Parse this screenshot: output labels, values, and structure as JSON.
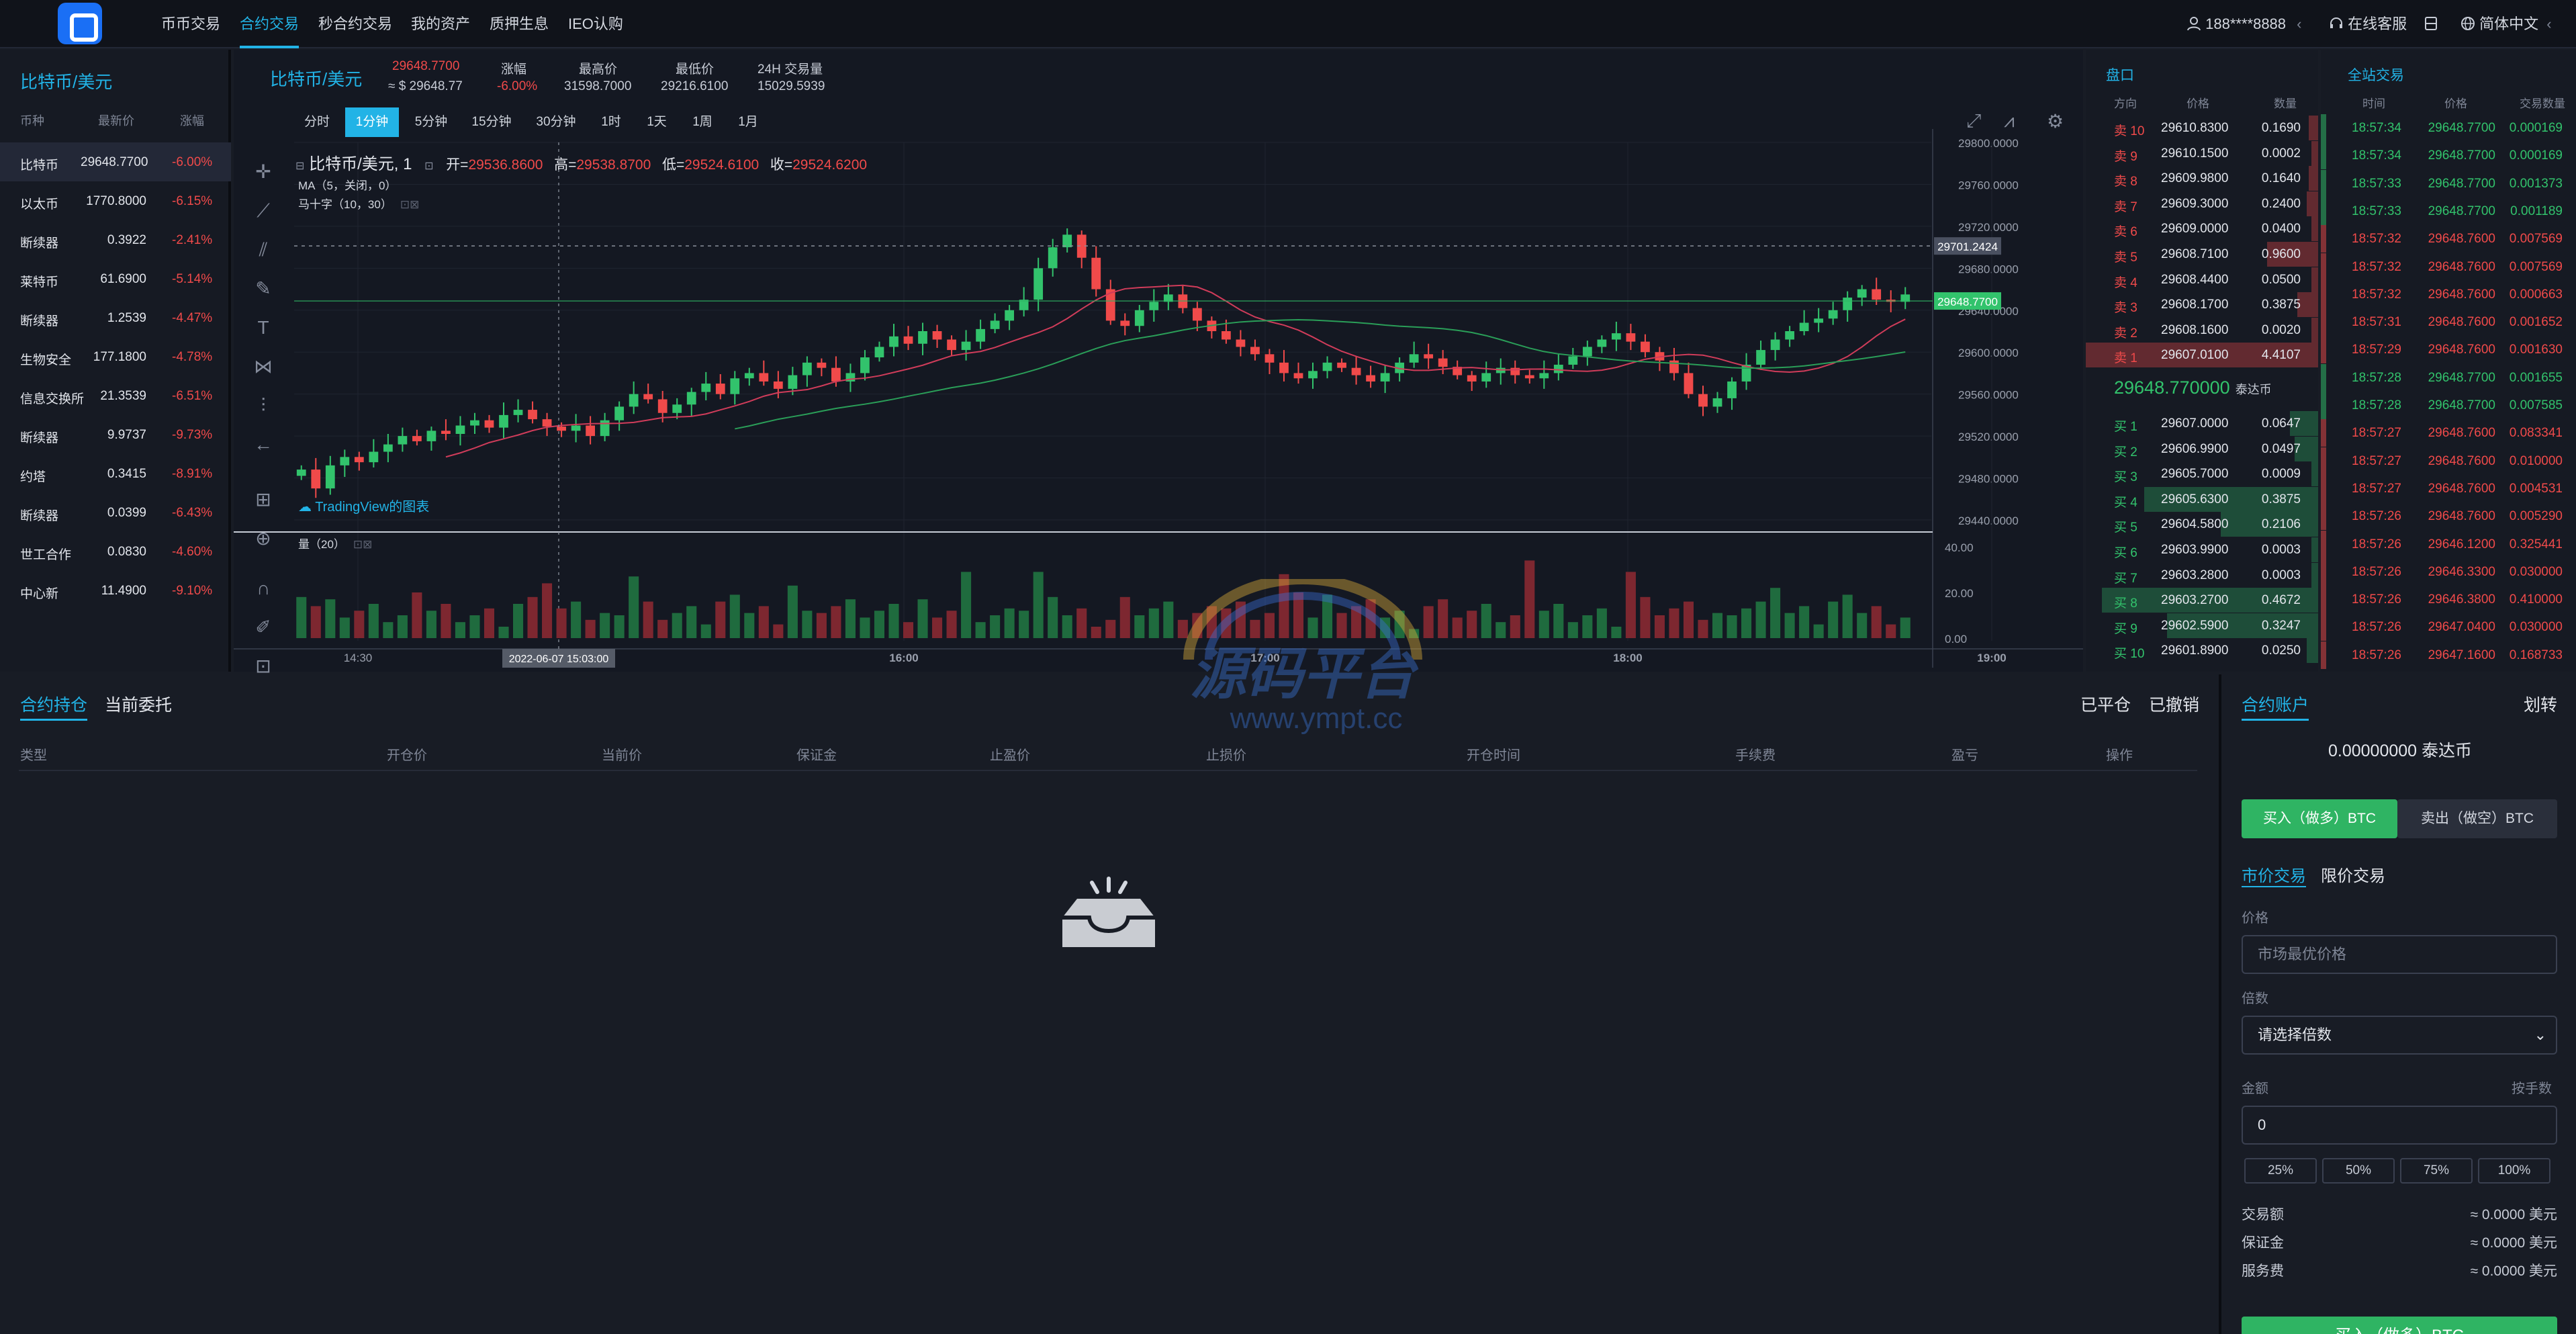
{
  "nav": {
    "items": [
      "币币交易",
      "合约交易",
      "秒合约交易",
      "我的资产",
      "质押生息",
      "IEO认购"
    ],
    "active": "合约交易",
    "user": "188****8888",
    "user_arrow": "‹",
    "service": "在线客服",
    "language": "简体中文",
    "lang_arrow": "‹"
  },
  "left_panel": {
    "title": "比特币/美元",
    "headers": [
      "币种",
      "最新价",
      "涨幅"
    ],
    "coins": [
      {
        "name": "比特币",
        "price": "29648.7700",
        "change": "-6.00%"
      },
      {
        "name": "以太币",
        "price": "1770.8000",
        "change": "-6.15%"
      },
      {
        "name": "断续器",
        "price": "0.3922",
        "change": "-2.41%"
      },
      {
        "name": "莱特币",
        "price": "61.6900",
        "change": "-5.14%"
      },
      {
        "name": "断续器",
        "price": "1.2539",
        "change": "-4.47%"
      },
      {
        "name": "生物安全",
        "price": "177.1800",
        "change": "-4.78%"
      },
      {
        "name": "信息交换所",
        "price": "21.3539",
        "change": "-6.51%"
      },
      {
        "name": "断续器",
        "price": "9.9737",
        "change": "-9.73%"
      },
      {
        "name": "约塔",
        "price": "0.3415",
        "change": "-8.91%"
      },
      {
        "name": "断续器",
        "price": "0.0399",
        "change": "-6.43%"
      },
      {
        "name": "世工合作",
        "price": "0.0830",
        "change": "-4.60%"
      },
      {
        "name": "中心新",
        "price": "11.4900",
        "change": "-9.10%"
      }
    ]
  },
  "ticker": {
    "pair": "比特币/美元",
    "last": "29648.7700",
    "last_usd": "≈ $ 29648.77",
    "change_label": "涨幅",
    "change": "-6.00%",
    "high_label": "最高价",
    "high": "31598.7000",
    "low_label": "最低价",
    "low": "29216.6100",
    "vol_label": "24H 交易量",
    "vol": "15029.5939"
  },
  "periods": [
    "分时",
    "1分钟",
    "5分钟",
    "15分钟",
    "30分钟",
    "1时",
    "1天",
    "1周",
    "1月"
  ],
  "active_period": "1分钟",
  "chart_legend": {
    "symbol": "比特币/美元, 1",
    "open_label": "开=",
    "open": "29536.8600",
    "high_label": "高=",
    "high": "29538.8700",
    "low_label": "低=",
    "low": "29524.6100",
    "close_label": "收=",
    "close": "29524.6200",
    "ma": "MA（5，关闭，0）",
    "ma2": "马十字（10，30）",
    "vol": "量（20）",
    "branding": "TradingView的图表"
  },
  "chart_data": {
    "type": "candlestick",
    "y_ticks": [
      "29800.0000",
      "29760.0000",
      "29720.0000",
      "29680.0000",
      "29640.0000",
      "29600.0000",
      "29560.0000",
      "29520.0000",
      "29480.0000",
      "29440.0000"
    ],
    "y_range": [
      29440,
      29800
    ],
    "price_tags": [
      {
        "label": "29701.2424",
        "color": "#4a5060"
      },
      {
        "label": "29648.7700",
        "color": "#32c36c"
      }
    ],
    "x_ticks": [
      "14:30",
      "16:00",
      "17:00",
      "18:00",
      "19:00"
    ],
    "crosshair_date": "2022-06-07 15:03:00",
    "vol_ticks": [
      "40.00",
      "20.00",
      "0.00"
    ],
    "vol_range": [
      0,
      40
    ],
    "candles": [
      29488,
      29470,
      29492,
      29500,
      29495,
      29505,
      29512,
      29520,
      29515,
      29525,
      29522,
      29530,
      29535,
      29528,
      29540,
      29545,
      29536,
      29529,
      29525,
      29530,
      29520,
      29535,
      29548,
      29560,
      29555,
      29542,
      29550,
      29562,
      29570,
      29560,
      29575,
      29580,
      29572,
      29565,
      29578,
      29590,
      29585,
      29572,
      29580,
      29595,
      29605,
      29615,
      29608,
      29620,
      29612,
      29602,
      29610,
      29622,
      29630,
      29640,
      29650,
      29680,
      29700,
      29712,
      29690,
      29660,
      29630,
      29625,
      29640,
      29648,
      29655,
      29642,
      29630,
      29620,
      29612,
      29605,
      29598,
      29590,
      29580,
      29575,
      29582,
      29590,
      29585,
      29578,
      29572,
      29580,
      29590,
      29598,
      29594,
      29586,
      29578,
      29572,
      29580,
      29585,
      29578,
      29575,
      29580,
      29588,
      29596,
      29605,
      29612,
      29618,
      29610,
      29600,
      29592,
      29580,
      29560,
      29548,
      29556,
      29572,
      29588,
      29602,
      29612,
      29620,
      29628,
      29632,
      29640,
      29652,
      29660,
      29650,
      29648,
      29655
    ]
  },
  "orderbook": {
    "title": "盘口",
    "cols": [
      "方向",
      "价格",
      "数量"
    ],
    "asks": [
      {
        "side": "卖 10",
        "price": "29610.8300",
        "qty": "0.1690",
        "depth": 0.04
      },
      {
        "side": "卖 9",
        "price": "29610.1500",
        "qty": "0.0002",
        "depth": 0.01
      },
      {
        "side": "卖 8",
        "price": "29609.9800",
        "qty": "0.1640",
        "depth": 0.04
      },
      {
        "side": "卖 7",
        "price": "29609.3000",
        "qty": "0.2400",
        "depth": 0.05
      },
      {
        "side": "卖 6",
        "price": "29609.0000",
        "qty": "0.0400",
        "depth": 0.01
      },
      {
        "side": "卖 5",
        "price": "29608.7100",
        "qty": "0.9600",
        "depth": 0.22
      },
      {
        "side": "卖 4",
        "price": "29608.4400",
        "qty": "0.0500",
        "depth": 0.01
      },
      {
        "side": "卖 3",
        "price": "29608.1700",
        "qty": "0.3875",
        "depth": 0.09
      },
      {
        "side": "卖 2",
        "price": "29608.1600",
        "qty": "0.0020",
        "depth": 0.01
      },
      {
        "side": "卖 1",
        "price": "29607.0100",
        "qty": "4.4107",
        "depth": 1.0
      }
    ],
    "mid": "29648.770000",
    "mid_unit": "泰达币",
    "bids": [
      {
        "side": "买 1",
        "price": "29607.0000",
        "qty": "0.0647",
        "depth": 0.12
      },
      {
        "side": "买 2",
        "price": "29606.9900",
        "qty": "0.0497",
        "depth": 0.1
      },
      {
        "side": "买 3",
        "price": "29605.7000",
        "qty": "0.0009",
        "depth": 0.01
      },
      {
        "side": "买 4",
        "price": "29605.6300",
        "qty": "0.3875",
        "depth": 0.75
      },
      {
        "side": "买 5",
        "price": "29604.5800",
        "qty": "0.2106",
        "depth": 0.42
      },
      {
        "side": "买 6",
        "price": "29603.9900",
        "qty": "0.0003",
        "depth": 0.01
      },
      {
        "side": "买 7",
        "price": "29603.2800",
        "qty": "0.0003",
        "depth": 0.01
      },
      {
        "side": "买 8",
        "price": "29603.2700",
        "qty": "0.4672",
        "depth": 0.93
      },
      {
        "side": "买 9",
        "price": "29602.5900",
        "qty": "0.3247",
        "depth": 0.65
      },
      {
        "side": "买 10",
        "price": "29601.8900",
        "qty": "0.0250",
        "depth": 0.05
      }
    ]
  },
  "trades": {
    "title": "全站交易",
    "cols": [
      "时间",
      "价格",
      "交易数量"
    ],
    "rows": [
      {
        "time": "18:57:34",
        "price": "29648.7700",
        "qty": "0.000169",
        "side": "buy"
      },
      {
        "time": "18:57:34",
        "price": "29648.7700",
        "qty": "0.000169",
        "side": "buy"
      },
      {
        "time": "18:57:33",
        "price": "29648.7700",
        "qty": "0.001373",
        "side": "buy"
      },
      {
        "time": "18:57:33",
        "price": "29648.7700",
        "qty": "0.001189",
        "side": "buy"
      },
      {
        "time": "18:57:32",
        "price": "29648.7600",
        "qty": "0.007569",
        "side": "sell"
      },
      {
        "time": "18:57:32",
        "price": "29648.7600",
        "qty": "0.007569",
        "side": "sell"
      },
      {
        "time": "18:57:32",
        "price": "29648.7600",
        "qty": "0.000663",
        "side": "sell"
      },
      {
        "time": "18:57:31",
        "price": "29648.7600",
        "qty": "0.001652",
        "side": "sell"
      },
      {
        "time": "18:57:29",
        "price": "29648.7600",
        "qty": "0.001630",
        "side": "sell"
      },
      {
        "time": "18:57:28",
        "price": "29648.7700",
        "qty": "0.001655",
        "side": "buy"
      },
      {
        "time": "18:57:28",
        "price": "29648.7700",
        "qty": "0.007585",
        "side": "buy"
      },
      {
        "time": "18:57:27",
        "price": "29648.7600",
        "qty": "0.083341",
        "side": "sell"
      },
      {
        "time": "18:57:27",
        "price": "29648.7600",
        "qty": "0.010000",
        "side": "sell"
      },
      {
        "time": "18:57:27",
        "price": "29648.7600",
        "qty": "0.004531",
        "side": "sell"
      },
      {
        "time": "18:57:26",
        "price": "29648.7600",
        "qty": "0.005290",
        "side": "sell"
      },
      {
        "time": "18:57:26",
        "price": "29646.1200",
        "qty": "0.325441",
        "side": "sell"
      },
      {
        "time": "18:57:26",
        "price": "29646.3300",
        "qty": "0.030000",
        "side": "sell"
      },
      {
        "time": "18:57:26",
        "price": "29646.3800",
        "qty": "0.410000",
        "side": "sell"
      },
      {
        "time": "18:57:26",
        "price": "29647.0400",
        "qty": "0.030000",
        "side": "sell"
      },
      {
        "time": "18:57:26",
        "price": "29647.1600",
        "qty": "0.168733",
        "side": "sell"
      }
    ]
  },
  "positions": {
    "tabs": [
      "合约持仓",
      "当前委托"
    ],
    "actions": [
      "已平仓",
      "已撤销"
    ],
    "headers": [
      "类型",
      "开仓价",
      "当前价",
      "保证金",
      "止盈价",
      "止损价",
      "开仓时间",
      "手续费",
      "盈亏",
      "操作"
    ]
  },
  "account": {
    "title": "合约账户",
    "transfer": "划转",
    "balance": "0.00000000 泰达币",
    "buy": "买入（做多）BTC",
    "sell": "卖出（做空）BTC",
    "mode_market": "市价交易",
    "mode_limit": "限价交易",
    "price_label": "价格",
    "price_placeholder": "市场最优价格",
    "leverage_label": "倍数",
    "leverage_value": "请选择倍数",
    "amount_label": "金额",
    "fee_label": "按手数",
    "amount_value": "0",
    "pcts": [
      "25%",
      "50%",
      "75%",
      "100%"
    ],
    "rows": [
      {
        "label": "交易额",
        "value": "≈ 0.0000 美元"
      },
      {
        "label": "保证金",
        "value": "≈ 0.0000 美元"
      },
      {
        "label": "服务费",
        "value": "≈ 0.0000 美元"
      }
    ],
    "submit": "买入（做多）BTC"
  },
  "watermark": {
    "title": "源码平台",
    "url": "www.ympt.cc"
  },
  "colors": {
    "accent": "#22b3e6",
    "up": "#32c36c",
    "down": "#f04a4a",
    "bg": "#181c25"
  }
}
